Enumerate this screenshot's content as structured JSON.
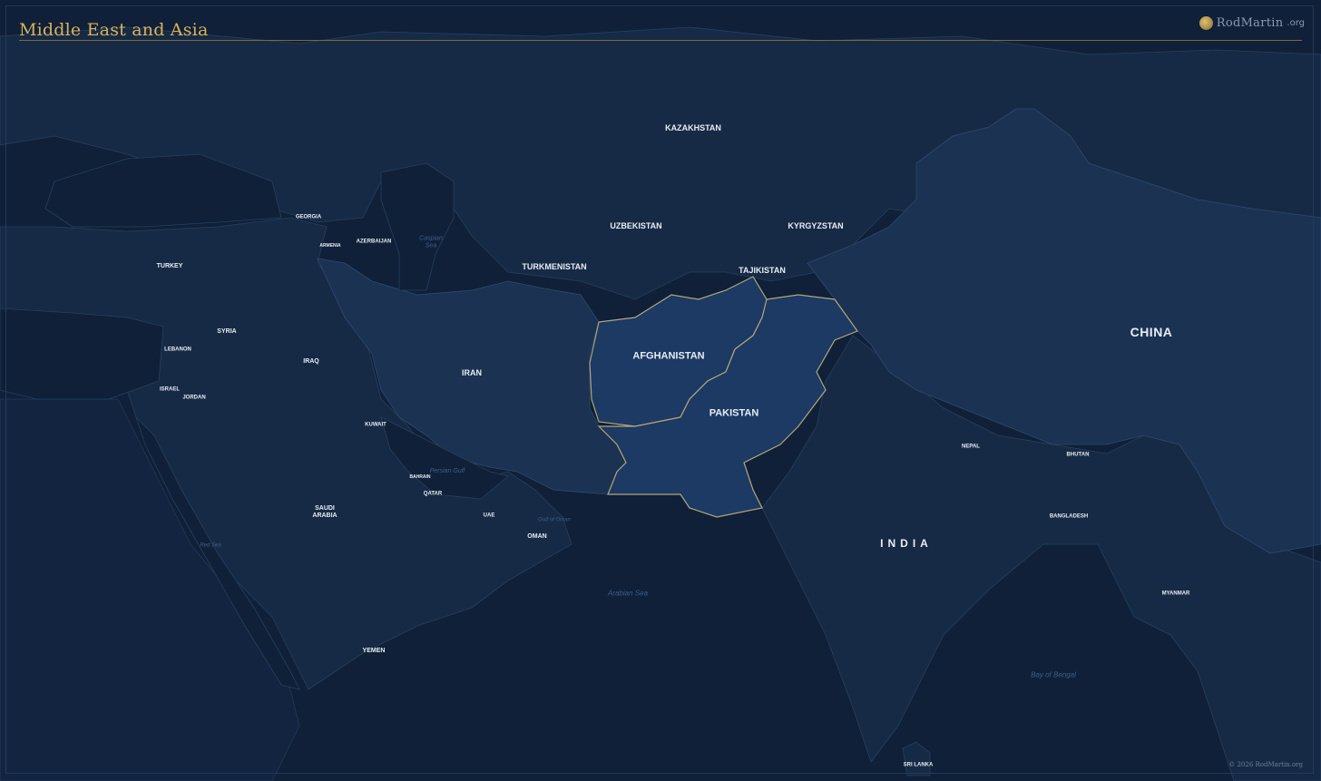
{
  "map": {
    "title": "Middle East and Asia",
    "logo": {
      "name": "RodMartin",
      "tld": ".org"
    },
    "copyright": "© 2026 RodMartin.org",
    "highlighted": [
      "AFGHANISTAN",
      "PAKISTAN"
    ],
    "colors": {
      "ocean": "#0f2038",
      "land": "#172a45",
      "china_iran": "#1b3252",
      "highlight": "#1c3a63",
      "highlight_border": "#b3a67a",
      "title": "#d9b25a"
    },
    "countries": {
      "kazakhstan": "KAZAKHSTAN",
      "uzbekistan": "UZBEKISTAN",
      "kyrgyzstan": "KYRGYZSTAN",
      "tajikistan": "TAJIKISTAN",
      "turkmenistan": "TURKMENISTAN",
      "georgia": "GEORGIA",
      "armenia": "ARMENIA",
      "azerbaijan": "AZERBAIJAN",
      "turkey": "TURKEY",
      "syria": "SYRIA",
      "lebanon": "LEBANON",
      "israel": "ISRAEL",
      "jordan": "JORDAN",
      "iraq": "IRAQ",
      "iran": "IRAN",
      "afghanistan": "AFGHANISTAN",
      "pakistan": "PAKISTAN",
      "china": "CHINA",
      "kuwait": "KUWAIT",
      "bahrain": "BAHRAIN",
      "qatar": "QATAR",
      "uae": "UAE",
      "saudi_arabia": "SAUDI\nARABIA",
      "oman": "OMAN",
      "yemen": "YEMEN",
      "india": "INDIA",
      "nepal": "NEPAL",
      "bhutan": "BHUTAN",
      "bangladesh": "BANGLADESH",
      "myanmar": "MYANMAR",
      "sri_lanka": "SRI LANKA"
    },
    "seas": {
      "caspian": "Caspian\nSea",
      "persian_gulf": "Persian Gulf",
      "gulf_of_oman": "Gulf of Oman",
      "red_sea": "Red Sea",
      "arabian_sea": "Arabian Sea",
      "bay_of_bengal": "Bay of Bengal"
    }
  }
}
